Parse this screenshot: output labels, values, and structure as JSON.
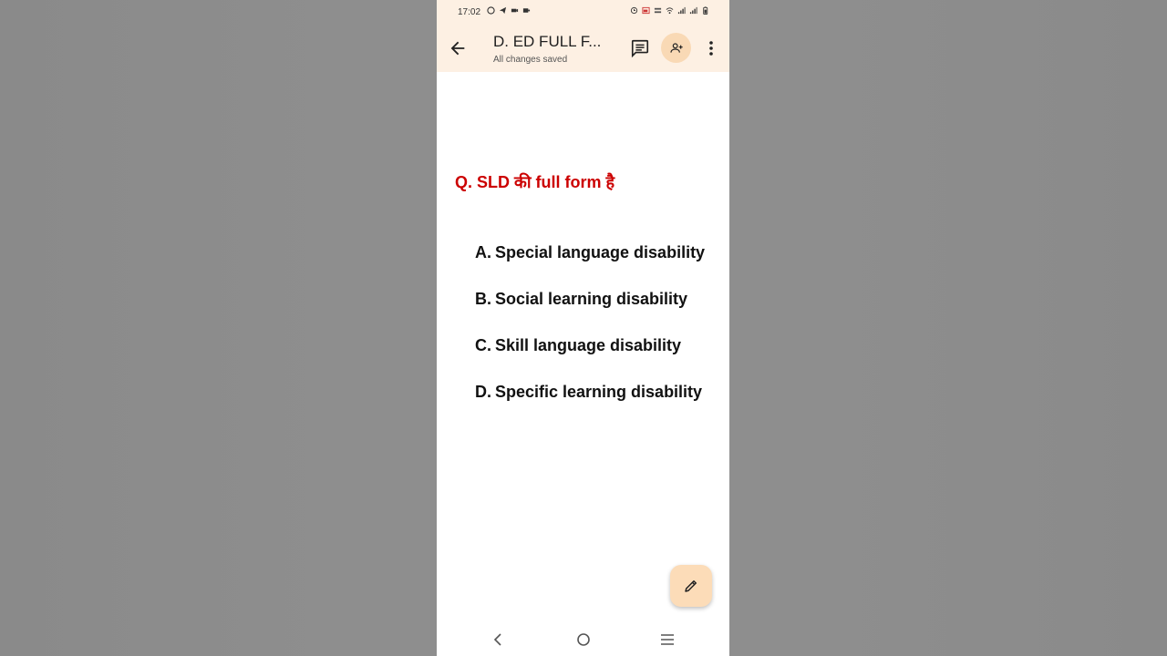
{
  "status_bar": {
    "time": "17:02",
    "left_icons": [
      "whatsapp-icon",
      "telegram-icon",
      "video-icon",
      "camera-icon"
    ],
    "right_icons": [
      "alarm-icon",
      "cast-icon",
      "volte-icon",
      "wifi-icon",
      "signal-icon",
      "signal-icon",
      "battery-icon"
    ]
  },
  "appbar": {
    "title": "D. ED FULL F...",
    "subtitle": "All changes saved",
    "icons": {
      "back": "arrow-back-icon",
      "comment": "comment-icon",
      "share": "person-add-icon",
      "more": "more-vert-icon"
    },
    "accent_color": "#fdf0e3",
    "share_color": "#f9d9b5"
  },
  "content": {
    "question": "Q. SLD की full form है",
    "question_color": "#cc0000",
    "options": [
      {
        "letter": "A.",
        "text": "Special language disability"
      },
      {
        "letter": "B.",
        "text": "Social learning disability"
      },
      {
        "letter": "C.",
        "text": "Skill language disability"
      },
      {
        "letter": "D.",
        "text": "Specific learning disability"
      }
    ]
  },
  "fab": {
    "icon": "pencil-icon",
    "color": "#fcdcb8"
  },
  "navbar": {
    "icons": [
      "nav-back-icon",
      "nav-home-icon",
      "nav-menu-icon"
    ]
  }
}
